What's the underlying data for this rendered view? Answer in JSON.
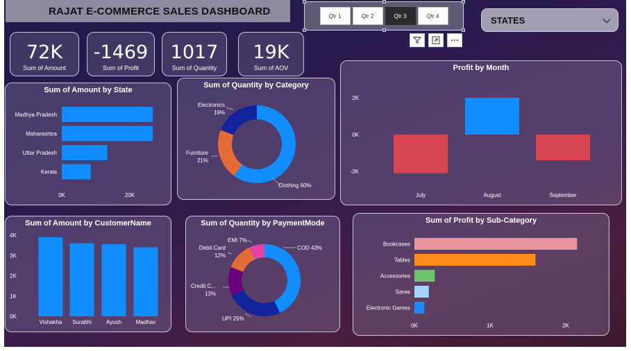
{
  "header": {
    "title": "RAJAT E-COMMERCE SALES DASHBOARD"
  },
  "slicer": {
    "options": [
      "Qtr 1",
      "Qtr 2",
      "Qtr 3",
      "Qtr 4"
    ],
    "selected": "Qtr 3"
  },
  "visual_header_icons": [
    "filter-icon",
    "focus-mode-icon",
    "more-options-icon"
  ],
  "states_slicer": {
    "label": "STATES",
    "icon": "chevron-down-icon"
  },
  "kpis": [
    {
      "value": "72K",
      "label": "Sum of Amount"
    },
    {
      "value": "-1469",
      "label": "Sum of Profit"
    },
    {
      "value": "1017",
      "label": "Sum of Quantity"
    },
    {
      "value": "19K",
      "label": "Sum of AOV"
    }
  ],
  "colors": {
    "primary": "#118dff",
    "negative": "#d64550",
    "furniture": "#e66c37",
    "electronics": "#12239e",
    "emi": "#e044a7",
    "credit_card": "#6b007b"
  },
  "chart_data": [
    {
      "id": "amount_by_state",
      "type": "bar",
      "orientation": "horizontal",
      "title": "Sum of Amount by State",
      "categories": [
        "Madhya Pradesh",
        "Maharashtra",
        "Uttar Pradesh",
        "Kerala"
      ],
      "values": [
        22000,
        22000,
        11000,
        7000
      ],
      "xticks": [
        "0K",
        "20K"
      ],
      "xlim": [
        0,
        25000
      ]
    },
    {
      "id": "quantity_by_category",
      "type": "pie",
      "donut": true,
      "title": "Sum of Quantity by Category",
      "slices": [
        {
          "name": "Clothing",
          "value": 60,
          "label": "Clothing 60%"
        },
        {
          "name": "Furniture",
          "value": 21,
          "label": "Furniture",
          "pct": "21%"
        },
        {
          "name": "Electronics",
          "value": 19,
          "label": "Electronics",
          "pct": "19%"
        }
      ]
    },
    {
      "id": "profit_by_month",
      "type": "bar",
      "title": "Profit by Month",
      "categories": [
        "July",
        "August",
        "September"
      ],
      "values": [
        -2100,
        2000,
        -1400
      ],
      "yticks": [
        {
          "v": 2000,
          "t": "2K"
        },
        {
          "v": 0,
          "t": "0K"
        },
        {
          "v": -2000,
          "t": "-2K"
        }
      ],
      "ylim": [
        -2300,
        2300
      ]
    },
    {
      "id": "amount_by_customer",
      "type": "bar",
      "title": "Sum of Amount by CustomerName",
      "categories": [
        "Vishakha",
        "Surabhi",
        "Ayush",
        "Madhav"
      ],
      "values": [
        3900,
        3600,
        3550,
        3400
      ],
      "yticks": [
        {
          "v": 4000,
          "t": "4K"
        },
        {
          "v": 3000,
          "t": "3K"
        },
        {
          "v": 2000,
          "t": "2K"
        },
        {
          "v": 1000,
          "t": "1K"
        },
        {
          "v": 0,
          "t": "0K"
        }
      ],
      "ylim": [
        0,
        4000
      ]
    },
    {
      "id": "quantity_by_paymentmode",
      "type": "pie",
      "donut": true,
      "title": "Sum of Quantity by PaymentMode",
      "slices": [
        {
          "name": "COD",
          "value": 43,
          "label": "COD 43%"
        },
        {
          "name": "UPI",
          "value": 25,
          "label": "UPI 25%"
        },
        {
          "name": "Credit Card",
          "value": 13,
          "label": "Credit C...",
          "pct": "13%"
        },
        {
          "name": "Debit Card",
          "value": 12,
          "label": "Debit Card",
          "pct": "12%"
        },
        {
          "name": "EMI",
          "value": 7,
          "label": "EMI 7%"
        }
      ]
    },
    {
      "id": "profit_by_subcategory",
      "type": "bar",
      "orientation": "horizontal",
      "title": "Sum of Profit by Sub-Category",
      "categories": [
        "Bookcases",
        "Tables",
        "Accessories",
        "Saree",
        "Electronic Games"
      ],
      "values": [
        2150,
        1600,
        270,
        190,
        130
      ],
      "colors": [
        "#e8969e",
        "#ff8c1a",
        "#6cc36a",
        "#a6d3ff",
        "#1a8cff"
      ],
      "xticks": [
        {
          "v": 0,
          "t": "0K"
        },
        {
          "v": 1000,
          "t": "1K"
        },
        {
          "v": 2000,
          "t": "2K"
        }
      ],
      "xlim": [
        0,
        2200
      ]
    }
  ]
}
